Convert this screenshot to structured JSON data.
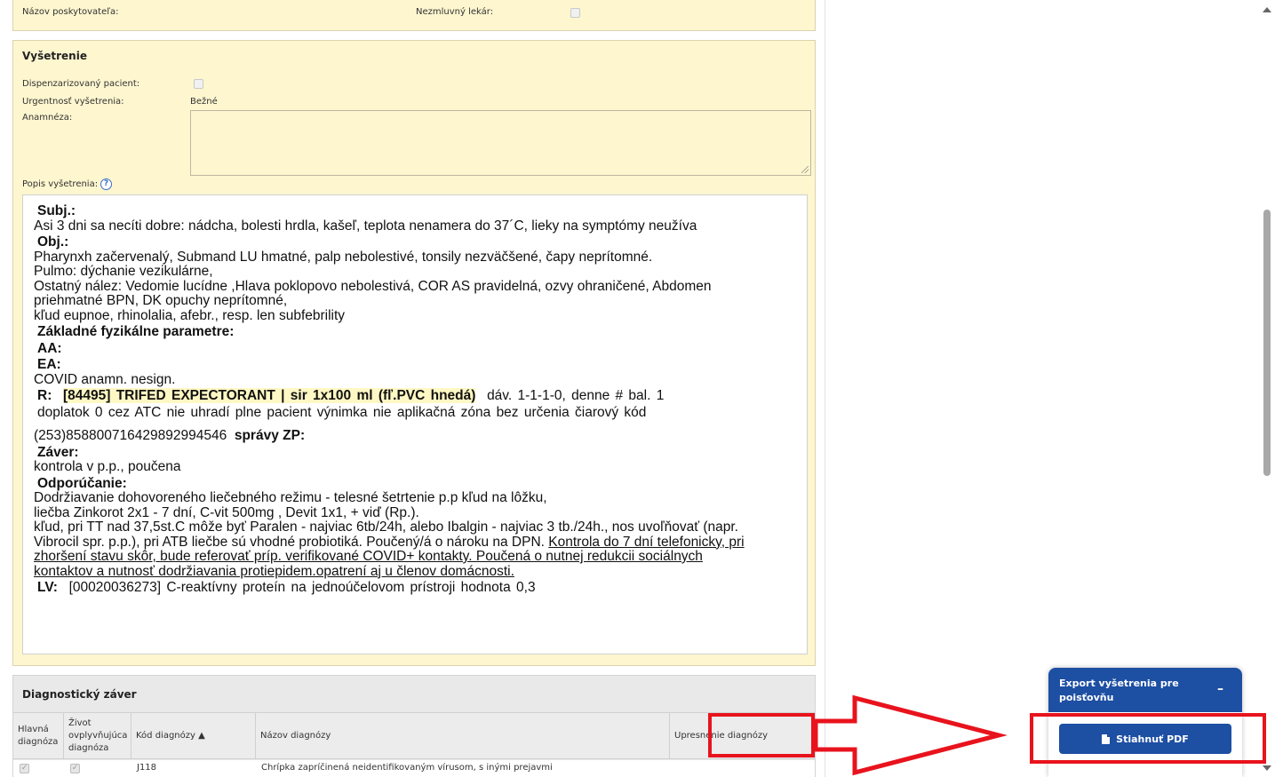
{
  "top_panel": {
    "provider_label": "Názov poskytovateľa:",
    "non_contract_label": "Nezmluvný lekár:"
  },
  "exam": {
    "title": "Vyšetrenie",
    "dispensary_label": "Dispenzarizovaný pacient:",
    "urgency_label": "Urgentnosť vyšetrenia:",
    "urgency_value": "Bežné",
    "anamnesis_label": "Anamnéza:",
    "description_label": "Popis vyšetrenia:",
    "help_glyph": "?",
    "editor": {
      "subj_h": "Subj.:",
      "subj_1": "Asi 3 dni sa necíti dobre: nádcha, bolesti hrdla, kašeľ, teplota nenamera do 37´C, lieky na symptómy neužíva",
      "obj_h": "Obj.:",
      "obj_1": "Pharynxh začervenalý, Submand LU hmatné, palp nebolestivé, tonsily nezväčšené, čapy neprítomné.",
      "obj_2": "Pulmo: dýchanie vezikulárne,",
      "obj_3": "Ostatný nález: Vedomie lucídne ,Hlava poklopovo nebolestivá, COR AS pravidelná, ozvy ohraničené, Abdomen",
      "obj_4": "priehmatné BPN, DK opuchy neprítomné,",
      "obj_5": "kľud eupnoe, rhinolalia, afebr., resp. len subfebrility",
      "params_h": "Základné fyzikálne parametre:",
      "aa_h": "AA:",
      "ea_h": "EA:",
      "ea_1": "COVID anamn. nesign.",
      "r_h": "R:",
      "r_drug": "[84495] TRIFED EXPECTORANT | sir 1x100 ml (fľ.PVC hnedá)",
      "r_rest": "dáv.  1-1-1-0, denne  # bal.  1",
      "r_line2": "doplatok  0  cez ATC  nie  uhradí  plne pacient  výnimka  nie  aplikačná zóna  bez určenia  čiarový kód",
      "r_line3": "(253)8588007164298929945​46",
      "zp_h": "správy ZP:",
      "zaver_h": "Záver:",
      "zaver_1": "kontrola v p.p., poučena",
      "odpor_h": "Odporúčanie:",
      "odpor_1": "Dodržiavanie dohovoreného liečebného režimu - telesné šetrtenie  p.p kľud na lôžku,",
      "odpor_2": "liečba Zinkorot 2x1 - 7 dní, C-vit 500mg , Devit 1x1,  + viď (Rp.).",
      "odpor_3": "kľud, pri TT nad 37,5st.C môže byť Paralen - najviac 6tb/24h, alebo Ibalgin - najviac 3 tb./24h., nos uvoľňovať (napr.",
      "odpor_4a": "Vibrocil spr. p.p.), pri ATB liečbe sú vhodné probiotiká. Poučený/á o nároku na DPN.  ",
      "odpor_4b": "Kontrola do 7 dní telefonicky, pri",
      "odpor_5": "zhoršení stavu skôr, bude referovať príp. verifikované COVID+ kontakty. Poučená o nutnej redukcii sociálnych",
      "odpor_6": "kontaktov a nutnosť dodržiavania protiepidem.opatrení aj u členov domácnosti.",
      "lv_h": "LV:",
      "lv_1": "[00020036273] C-reaktívny proteín na jednoúčelovom prístroji   hodnota  0,3"
    }
  },
  "diagnostics": {
    "title": "Diagnostický záver",
    "columns": [
      "Hlavná diagnóza",
      "Život ovplyvňujúca diagnóza",
      "Kód diagnózy ▲",
      "Názov diagnózy",
      "Upresnenie diagnózy"
    ],
    "col0_l1": "Hlavná",
    "col0_l2": "diagnóza",
    "col1_l1": "Život",
    "col1_l2": "ovplyvňujúca",
    "col1_l3": "diagnóza",
    "col2": "Kód diagnózy ▲",
    "col3": "Názov diagnózy",
    "col4": "Upresnenie diagnózy",
    "rows": [
      {
        "code": "J118",
        "name": "Chrípka zapríčinená neidentifikovaným vírusom, s inými prejavmi"
      }
    ],
    "check_glyph": "✓"
  },
  "export_widget": {
    "title": "Export vyšetrenia pre poisťovňu",
    "minimize_glyph": "–",
    "button_label": "Stiahnuť PDF",
    "accent": "#1d4fa3"
  },
  "annotation_color": "#e8131d"
}
